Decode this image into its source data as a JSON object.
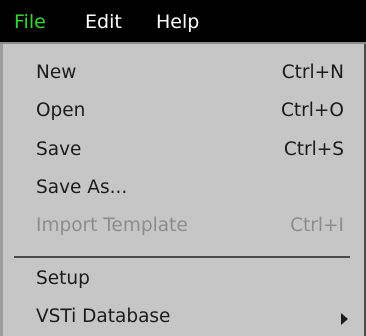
{
  "menubar": {
    "items": [
      {
        "label": "File"
      },
      {
        "label": "Edit"
      },
      {
        "label": "Help"
      }
    ]
  },
  "file_menu": {
    "items": [
      {
        "label": "New",
        "shortcut": "Ctrl+N"
      },
      {
        "label": "Open",
        "shortcut": "Ctrl+O"
      },
      {
        "label": "Save",
        "shortcut": "Ctrl+S"
      },
      {
        "label": "Save As...",
        "shortcut": ""
      },
      {
        "label": "Import Template",
        "shortcut": "Ctrl+I",
        "disabled": true
      },
      {
        "label": "Setup",
        "shortcut": ""
      },
      {
        "label": "VSTi Database",
        "shortcut": "",
        "submenu": true
      }
    ]
  },
  "colors": {
    "menubar_bg": "#000000",
    "menubar_text": "#ffffff",
    "menubar_active_text": "#35d335",
    "menu_bg": "#c6c6c6",
    "menu_text": "#1b1b1b",
    "menu_disabled_text": "#8d8d8d"
  }
}
